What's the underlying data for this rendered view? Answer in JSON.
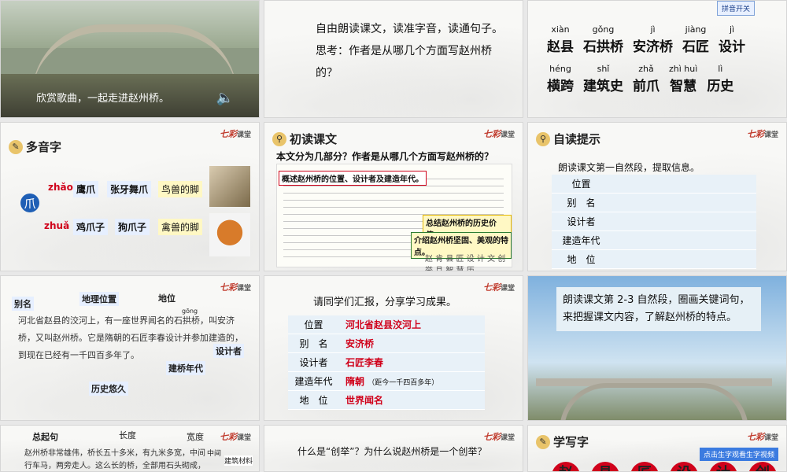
{
  "slides": [
    {
      "id": "s1",
      "caption": "欣赏歌曲，一起走进赵州桥。"
    },
    {
      "id": "s2",
      "text": "自由朗读课文，读准字音，读通句子。思考：作者是从哪几个方面写赵州桥的？"
    },
    {
      "id": "s3",
      "button": "拼音开关",
      "row1": [
        {
          "py": "xiàn",
          "hz": "赵县"
        },
        {
          "py": "gǒng",
          "hz": "石拱桥"
        },
        {
          "py": "jì",
          "hz": "安济桥"
        },
        {
          "py": "jiàng",
          "hz": "石匠"
        },
        {
          "py": "jì",
          "hz": "设计"
        }
      ],
      "row2": [
        {
          "py": "héng",
          "hz": "横跨"
        },
        {
          "py": "shǐ",
          "hz": "建筑史"
        },
        {
          "py": "zhǎ",
          "hz": "前爪"
        },
        {
          "py": "zhì huì",
          "hz": "智慧"
        },
        {
          "py": "lì",
          "hz": "历史"
        }
      ]
    },
    {
      "id": "s4",
      "title": "多音字",
      "char": "爪",
      "pron1": "zhǎo",
      "pron2": "zhuǎ",
      "words1": [
        "鹰爪",
        "张牙舞爪"
      ],
      "words2": [
        "鸡爪子",
        "狗爪子"
      ],
      "note1": "鸟兽的脚",
      "note2": "禽兽的脚"
    },
    {
      "id": "s5",
      "title": "初读课文",
      "question": "本文分为几部分？作者是从哪几个方面写赵州桥的？",
      "box1": "概述赵州桥的位置、设计者及建造年代。",
      "box2": "总结赵州桥的历史价值。",
      "box3": "介绍赵州桥坚固、美观的特点。",
      "footer": "赵 肯 县 匠 设 计 文 创 举 且 智 慧 历"
    },
    {
      "id": "s6",
      "title": "自读提示",
      "intro": "朗读课文第一自然段，提取信息。",
      "rows": [
        "位置",
        "别　名",
        "设计者",
        "建造年代",
        "地　位"
      ]
    },
    {
      "id": "s7",
      "labels": {
        "alias": "别名",
        "geo": "地理位置",
        "status": "地位",
        "designer": "设计者",
        "era": "建桥年代",
        "history": "历史悠久",
        "gong": "gōng"
      },
      "paragraph": "河北省赵县的洨河上，有一座世界闻名的石拱桥，叫安济桥，又叫赵州桥。它是隋朝的石匠李春设计并参加建造的，到现在已经有一千四百多年了。"
    },
    {
      "id": "s8",
      "heading": "请同学们汇报，分享学习成果。",
      "rows": [
        {
          "k": "位置",
          "v": "河北省赵县洨河上"
        },
        {
          "k": "别　名",
          "v": "安济桥"
        },
        {
          "k": "设计者",
          "v": "石匠李春"
        },
        {
          "k": "建造年代",
          "v": "隋朝",
          "sub": "（距今一千四百多年）"
        },
        {
          "k": "地　位",
          "v": "世界闻名"
        }
      ]
    },
    {
      "id": "s9",
      "text": "朗读课文第 2-3 自然段，圈画关键词句，来把握课文内容，了解赵州桥的特点。"
    },
    {
      "id": "s10",
      "labels": {
        "lead": "总起句",
        "length": "长度",
        "width": "宽度",
        "mid": "中间",
        "material": "建筑材料"
      },
      "paragraph": "赵州桥非常雄伟，桥长五十多米，有九米多宽，中间行车马，两旁走人。这么长的桥，全部用石头砌成，下面"
    },
    {
      "id": "s11",
      "question": "什么是“创举”？为什么说赵州桥是一个创举？"
    },
    {
      "id": "s12",
      "title": "学写字",
      "button": "点击生字观看生字视频",
      "chars": [
        "赵",
        "县",
        "匠",
        "设",
        "计",
        "创"
      ]
    }
  ],
  "logo": {
    "main": "七彩",
    "sub": "课堂"
  }
}
